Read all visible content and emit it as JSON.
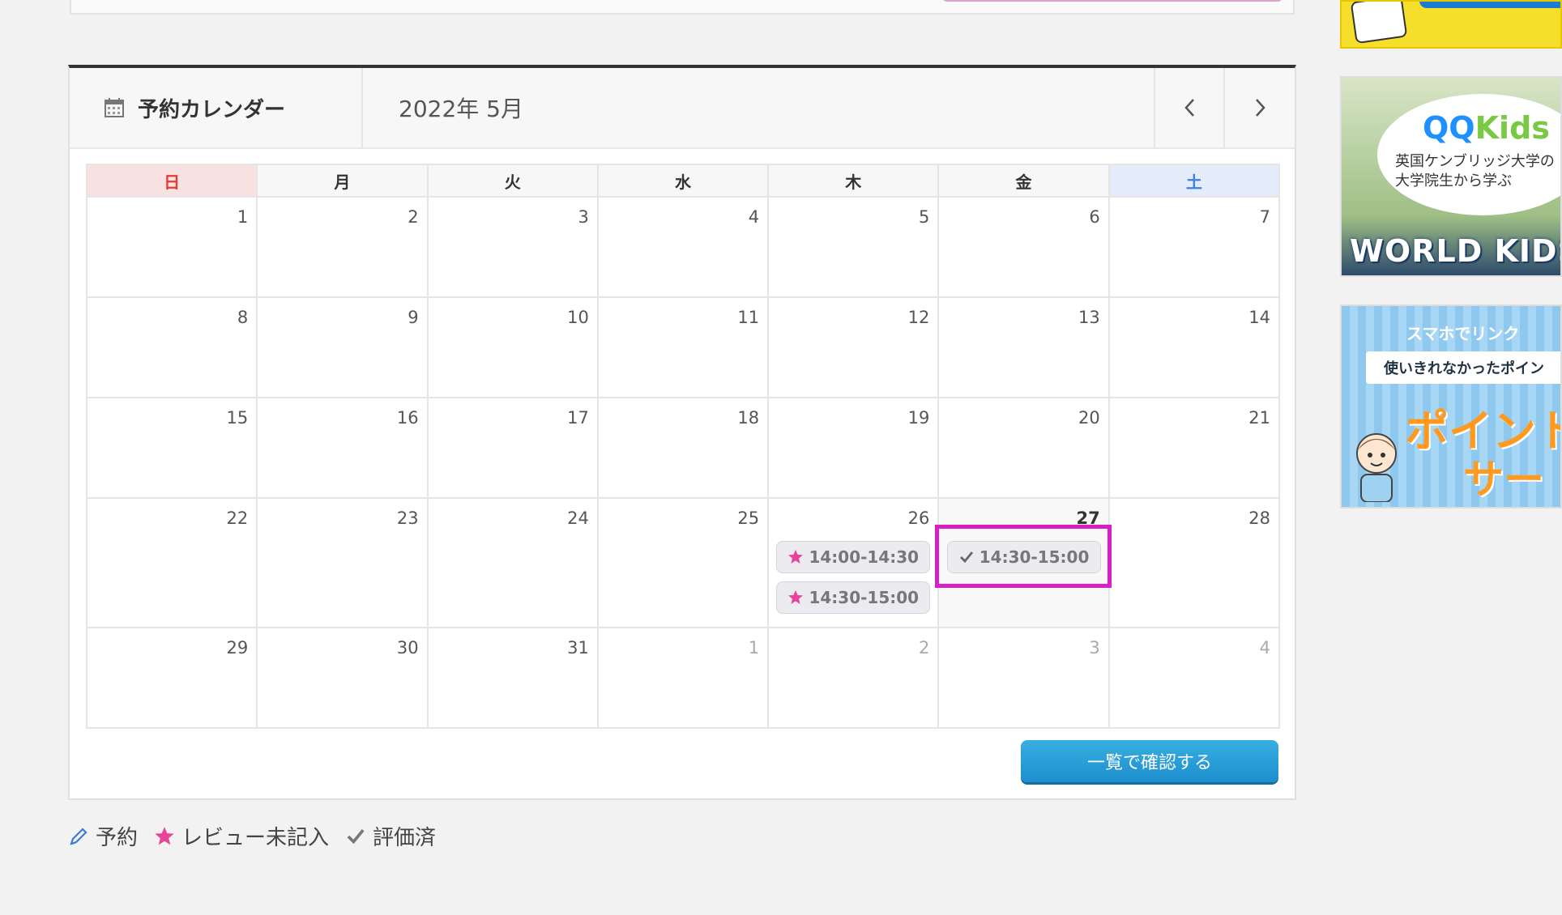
{
  "calendar": {
    "title": "予約カレンダー",
    "month": "2022年 5月",
    "weekdays": [
      "日",
      "月",
      "火",
      "水",
      "木",
      "金",
      "土"
    ],
    "weeks": [
      [
        "1",
        "2",
        "3",
        "4",
        "5",
        "6",
        "7"
      ],
      [
        "8",
        "9",
        "10",
        "11",
        "12",
        "13",
        "14"
      ],
      [
        "15",
        "16",
        "17",
        "18",
        "19",
        "20",
        "21"
      ],
      [
        "22",
        "23",
        "24",
        "25",
        "26",
        "27",
        "28"
      ],
      [
        "29",
        "30",
        "31",
        "1",
        "2",
        "3",
        "4"
      ]
    ],
    "slots": {
      "thu26_a": "14:00-14:30",
      "thu26_b": "14:30-15:00",
      "fri27_a": "14:30-15:00"
    },
    "list_button": "一覧で確認する"
  },
  "legend": {
    "reserve": "予約",
    "review_pending": "レビュー未記入",
    "rated": "評価済"
  },
  "ads": {
    "ad2_brand_a": "QQ",
    "ad2_brand_b": "Kids",
    "ad2_sub": "英国ケンブリッジ大学の 大学院生から学ぶ",
    "ad2_bottom": "WORLD KIDS C",
    "ad3_top": "スマホでリンク",
    "ad3_bar": "使いきれなかったポイン",
    "ad3_big1": "ポイント",
    "ad3_big2": "サー"
  },
  "colors": {
    "star": "#e8449a",
    "highlight": "#d91fc6",
    "sunday": "#e53935",
    "saturday": "#3b82e6",
    "button": "#1e8fce"
  }
}
